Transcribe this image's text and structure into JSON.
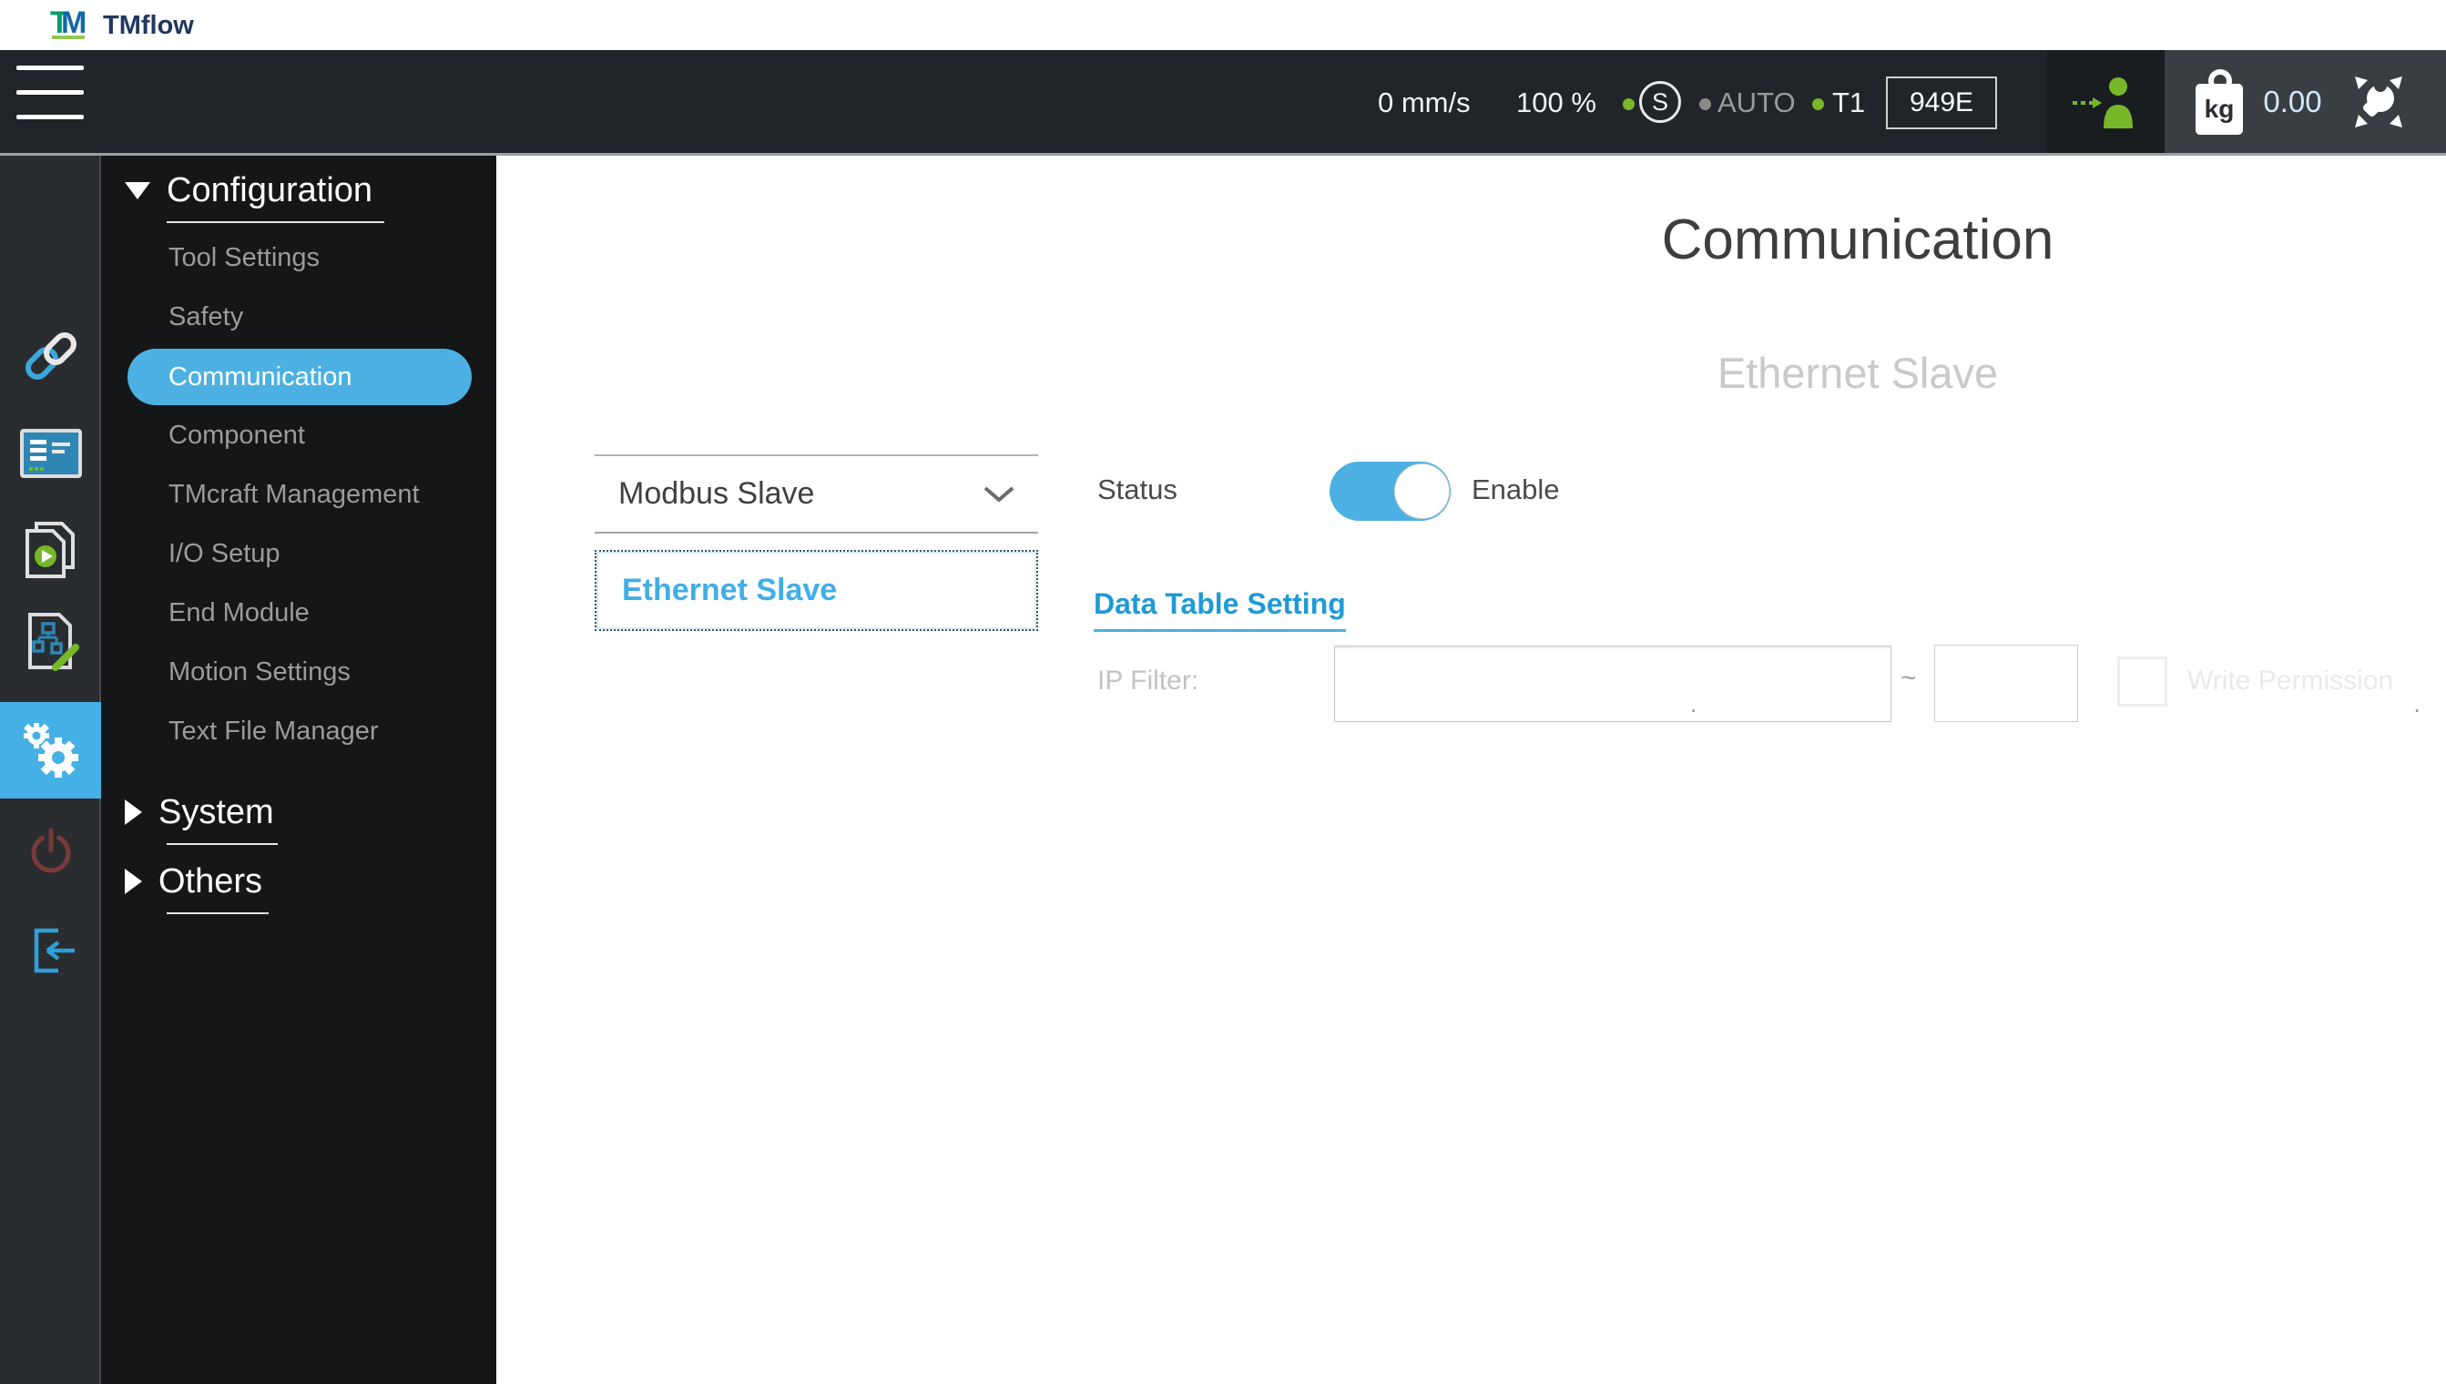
{
  "titlebar": {
    "logo_mark_t": "T",
    "logo_mark_m": "M",
    "logo_text": "TMflow"
  },
  "topbar": {
    "speed": "0 mm/s",
    "percent": "100 %",
    "s_badge": "S",
    "mode": "AUTO",
    "station": "T1",
    "code": "949E",
    "kg_label": "kg",
    "payload": "0.00"
  },
  "sidebar": {
    "icons": [
      "link",
      "monitor",
      "project-play",
      "flowchart-edit",
      "settings-gear",
      "power",
      "logout"
    ],
    "active_icon": "settings-gear"
  },
  "menu": {
    "configuration": "Configuration",
    "items": [
      "Tool Settings",
      "Safety",
      "Communication",
      "Component",
      "TMcraft Management",
      "I/O Setup",
      "End Module",
      "Motion Settings",
      "Text File Manager"
    ],
    "active_item": "Communication",
    "system": "System",
    "others": "Others"
  },
  "main": {
    "title": "Communication",
    "subtitle": "Ethernet Slave",
    "dropdown_value": "Modbus Slave",
    "ethernet_button": "Ethernet Slave",
    "status_label": "Status",
    "status_value": "Enable",
    "status_enabled": true,
    "data_table_link": "Data Table Setting",
    "ip_filter_label": "IP Filter:",
    "ip_separator": ".",
    "ip_value_start": "",
    "ip_value_end": "",
    "range_separator": "~",
    "write_permission": "Write Permission",
    "write_permission_checked": false
  },
  "colors": {
    "accent_blue": "#4cb1e2",
    "brand_green": "#76b82a",
    "power_red": "#7a3a3a",
    "topbar_bg": "#212529",
    "menu_bg": "#141618"
  }
}
